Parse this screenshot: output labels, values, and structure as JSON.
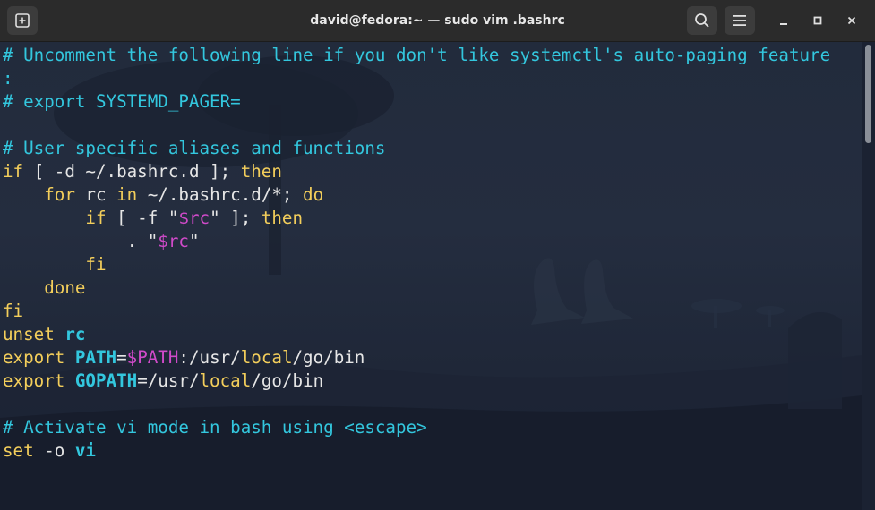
{
  "window": {
    "title": "david@fedora:~ — sudo vim .bashrc"
  },
  "titlebar": {
    "new_tab_icon": "new-tab-icon",
    "search_icon": "search-icon",
    "menu_icon": "hamburger-menu-icon",
    "minimize_icon": "minimize-icon",
    "maximize_icon": "maximize-icon",
    "close_icon": "close-icon"
  },
  "editor": {
    "lines": [
      [
        {
          "t": "# Uncomment the following line if you don't like systemctl's auto-paging feature",
          "c": "comment"
        }
      ],
      [
        {
          "t": ":",
          "c": "comment"
        }
      ],
      [
        {
          "t": "# export SYSTEMD_PAGER=",
          "c": "comment"
        }
      ],
      [],
      [
        {
          "t": "# User specific aliases and functions",
          "c": "comment"
        }
      ],
      [
        {
          "t": "if",
          "c": "kw"
        },
        {
          "t": " [ -d ~/.bashrc.d ]; "
        },
        {
          "t": "then",
          "c": "kw"
        }
      ],
      [
        {
          "t": "    "
        },
        {
          "t": "for",
          "c": "kw"
        },
        {
          "t": " rc "
        },
        {
          "t": "in",
          "c": "kw"
        },
        {
          "t": " ~/.bashrc.d/*; "
        },
        {
          "t": "do",
          "c": "kw"
        }
      ],
      [
        {
          "t": "        "
        },
        {
          "t": "if",
          "c": "kw"
        },
        {
          "t": " [ -f \""
        },
        {
          "t": "$rc",
          "c": "str"
        },
        {
          "t": "\" ]; "
        },
        {
          "t": "then",
          "c": "kw"
        }
      ],
      [
        {
          "t": "            . \""
        },
        {
          "t": "$rc",
          "c": "str"
        },
        {
          "t": "\""
        }
      ],
      [
        {
          "t": "        "
        },
        {
          "t": "fi",
          "c": "kw"
        }
      ],
      [
        {
          "t": "    "
        },
        {
          "t": "done",
          "c": "kw"
        }
      ],
      [
        {
          "t": "fi",
          "c": "kw"
        }
      ],
      [
        {
          "t": "unset",
          "c": "kw"
        },
        {
          "t": " "
        },
        {
          "t": "rc",
          "c": "var"
        }
      ],
      [
        {
          "t": "export",
          "c": "kw"
        },
        {
          "t": " "
        },
        {
          "t": "PATH",
          "c": "var"
        },
        {
          "t": "="
        },
        {
          "t": "$PATH",
          "c": "str"
        },
        {
          "t": ":/usr/"
        },
        {
          "t": "local",
          "c": "path"
        },
        {
          "t": "/go/bin"
        }
      ],
      [
        {
          "t": "export",
          "c": "kw"
        },
        {
          "t": " "
        },
        {
          "t": "GOPATH",
          "c": "var"
        },
        {
          "t": "=/usr/"
        },
        {
          "t": "local",
          "c": "path"
        },
        {
          "t": "/go/bin"
        }
      ],
      [],
      [
        {
          "t": "# Activate vi mode in bash using <escape>",
          "c": "comment"
        }
      ],
      [
        {
          "t": "set",
          "c": "kw"
        },
        {
          "t": " -o "
        },
        {
          "t": "vi",
          "c": "var"
        }
      ]
    ]
  }
}
